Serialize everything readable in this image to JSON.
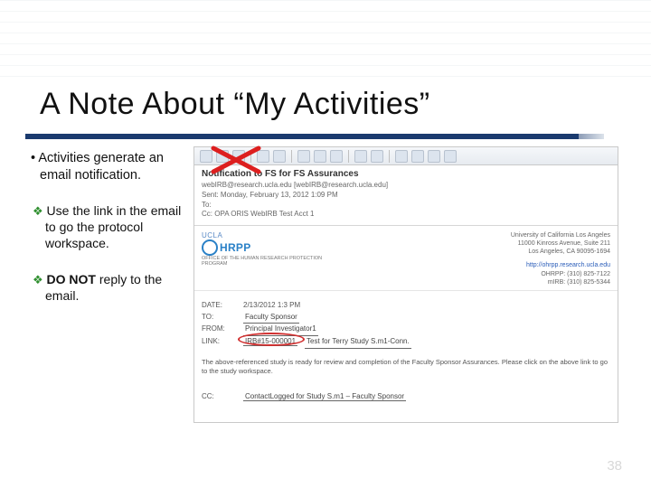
{
  "title": "A Note About “My Activities”",
  "bullets": {
    "b1": "Activities generate an email notification.",
    "b2_pre": "Use the link in the email to go the protocol workspace.",
    "b3_strong": "DO NOT",
    "b3_rest": " reply to the email."
  },
  "email": {
    "subject": "Notification to FS for FS Assurances",
    "from_line": "webIRB@research.ucla.edu [webIRB@research.ucla.edu]",
    "sent_line": "Sent: Monday, February 13, 2012 1:09 PM",
    "to_line": "To:",
    "cc_line": "Cc:   OPA ORIS WebIRB Test Acct 1",
    "logo_small": "UCLA",
    "logo_main": "HRPP",
    "logo_sub": "OFFICE OF THE HUMAN RESEARCH PROTECTION PROGRAM",
    "addr": {
      "l1": "University of California Los Angeles",
      "l2": "11000 Kinross Avenue, Suite 211",
      "l3": "Los Angeles, CA 90095-1694",
      "l4": "http://ohrpp.research.ucla.edu",
      "l5": "OHRPP: (310) 825-7122",
      "l6": "mIRB: (310) 825-5344"
    },
    "fields": {
      "date_lbl": "DATE:",
      "date_val": "2/13/2012 1:3 PM",
      "to_lbl": "TO:",
      "to_val": "Faculty Sponsor",
      "from_lbl": "FROM:",
      "from_val": "Principal Investigator1",
      "link_lbl": "LINK:",
      "link_val": "IRB#15-000001",
      "link_after": "Test for Terry Study S.m1-Conn."
    },
    "body": "The above-referenced study is ready for review and completion of the Faculty Sponsor Assurances. Please click on the above link to go to the study workspace.",
    "cc_lbl": "CC:",
    "cc_val": "ContactLogged for Study S.m1 – Faculty Sponsor"
  },
  "page": "38"
}
